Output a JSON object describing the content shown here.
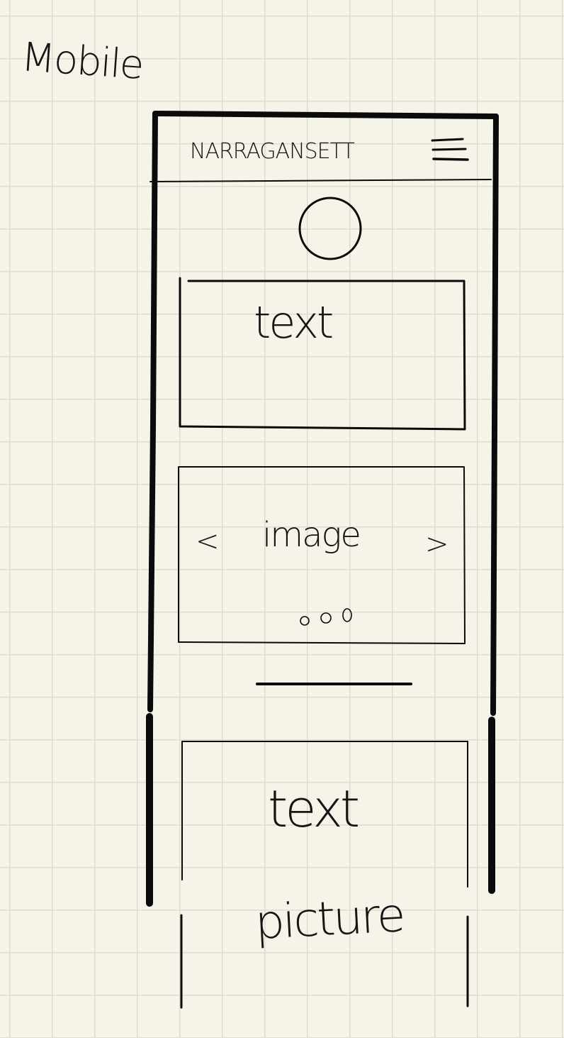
{
  "page": {
    "title": "Mobile"
  },
  "header": {
    "brand": "NARRAGANSETT",
    "menu_icon": "hamburger-menu-icon"
  },
  "logo": {
    "icon": "circle-logo"
  },
  "text_box_1": {
    "label": "text"
  },
  "carousel": {
    "label": "image",
    "prev": "<",
    "next": ">",
    "dot_count": 3
  },
  "section_2": {
    "text_label": "text",
    "picture_label": "picture"
  },
  "colors": {
    "paper": "#f6f4e9",
    "grid": "#dcdccf",
    "ink": "#0b0b0b"
  }
}
